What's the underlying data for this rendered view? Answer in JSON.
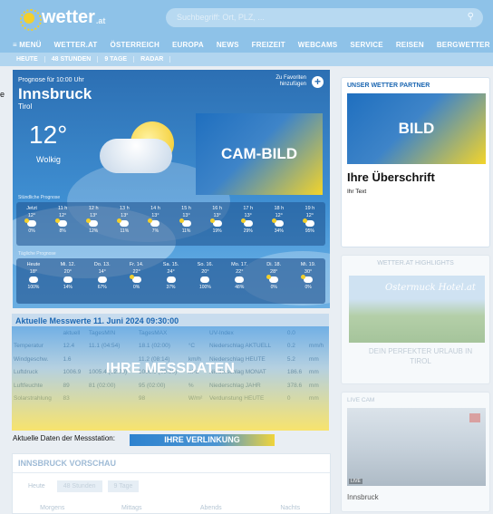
{
  "header": {
    "logo_main": "wetter",
    "logo_suffix": ".at",
    "search_placeholder": "Suchbegriff: Ort, PLZ, ...",
    "search_icon": "magnifier-icon"
  },
  "nav": {
    "items": [
      "≡ MENÜ",
      "WETTER.AT",
      "ÖSTERREICH",
      "EUROPA",
      "NEWS",
      "FREIZEIT",
      "WEBCAMS",
      "SERVICE",
      "REISEN",
      "BERGWETTER"
    ]
  },
  "subnav": {
    "items": [
      "HEUTE",
      "48 STUNDEN",
      "9 TAGE",
      "RADAR"
    ]
  },
  "forecast": {
    "label": "Prognose für 10:00 Uhr",
    "city": "Innsbruck",
    "region": "Tirol",
    "temp": "12°",
    "condition": "Wolkig",
    "fav_line1": "Zu Favoriten",
    "fav_line2": "hinzufügen",
    "fav_btn": "+",
    "cam": "CAM-BILD",
    "hourly_label": "Stündliche Prognose",
    "hourly": [
      {
        "t": "Jetzt",
        "v": "12°",
        "p": "0%"
      },
      {
        "t": "11 h",
        "v": "12°",
        "p": "8%"
      },
      {
        "t": "12 h",
        "v": "13°",
        "p": "12%"
      },
      {
        "t": "13 h",
        "v": "13°",
        "p": "11%"
      },
      {
        "t": "14 h",
        "v": "13°",
        "p": "7%"
      },
      {
        "t": "15 h",
        "v": "13°",
        "p": "11%"
      },
      {
        "t": "16 h",
        "v": "13°",
        "p": "19%"
      },
      {
        "t": "17 h",
        "v": "13°",
        "p": "29%"
      },
      {
        "t": "18 h",
        "v": "12°",
        "p": "34%"
      },
      {
        "t": "19 h",
        "v": "12°",
        "p": "95%"
      }
    ],
    "daily_label": "Tägliche Prognose",
    "daily": [
      {
        "t": "Heute",
        "v": "18°",
        "p": "100%"
      },
      {
        "t": "Mi. 12.",
        "v": "20°",
        "p": "14%"
      },
      {
        "t": "Do. 13.",
        "v": "14°",
        "p": "67%"
      },
      {
        "t": "Fr. 14.",
        "v": "22°",
        "p": "0%"
      },
      {
        "t": "Sa. 15.",
        "v": "24°",
        "p": "37%"
      },
      {
        "t": "So. 16.",
        "v": "20°",
        "p": "100%"
      },
      {
        "t": "Mo. 17.",
        "v": "22°",
        "p": "48%"
      },
      {
        "t": "Di. 18.",
        "v": "28°",
        "p": "0%"
      },
      {
        "t": "Mi. 19.",
        "v": "30°",
        "p": "0%"
      }
    ]
  },
  "measure": {
    "title": "Aktuelle Messwerte 11. Juni 2024 09:30:00",
    "overlay": "IHRE MESSDATEN",
    "rows": [
      [
        "",
        "aktuell",
        "TagesMIN",
        "TagesMAX",
        "",
        "UV-Index",
        "0.0",
        ""
      ],
      [
        "Temperatur",
        "12.4",
        "11.1 (04:54)",
        "18.1 (02:00)",
        "°C",
        "Niederschlag AKTUELL",
        "0.2",
        "mm/h"
      ],
      [
        "Windgeschw.",
        "1.6",
        "",
        "11.2 (08:14)",
        "km/h",
        "Niederschlag HEUTE",
        "5.2",
        "mm"
      ],
      [
        "Luftdruck",
        "1006.9",
        "1005.4 (02:00)",
        "1006.9 (09:30)",
        "hPa",
        "Niederschlag MONAT",
        "186.6",
        "mm"
      ],
      [
        "Luftfeuchte",
        "89",
        "81 (02:00)",
        "95 (02:00)",
        "%",
        "Niederschlag JAHR",
        "378.6",
        "mm"
      ],
      [
        "Solarstrahlung",
        "83",
        "",
        "98",
        "W/m²",
        "Verdunstung HEUTE",
        "0",
        "mm"
      ]
    ]
  },
  "station": {
    "label": "Aktuelle Daten der Messstation:",
    "link": "IHRE VERLINKUNG"
  },
  "vorschau": {
    "title": "INNSBRUCK VORSCHAU",
    "tabs": [
      "Heute",
      "48 Stunden",
      "9 Tage"
    ],
    "cols": [
      "Morgens",
      "Mittags",
      "Abends",
      "Nachts"
    ]
  },
  "partner": {
    "label": "UNSER WETTER PARTNER",
    "img": "BILD",
    "title": "Ihre Überschrift",
    "text": "Ihr Text"
  },
  "highlights": {
    "label": "WETTER.AT HIGHLIGHTS",
    "script": "Ostermuck Hotel.at",
    "caption": "DEIN PERFEKTER URLAUB IN TIROL"
  },
  "livecam": {
    "label": "LIVE CAM",
    "tag": "LIVE",
    "caption": "Innsbruck"
  },
  "edge": {
    "letter": "e"
  },
  "colors": {
    "brand": "#8ec2e8",
    "accent": "#1c67b2",
    "yellow": "#f3d42a"
  }
}
